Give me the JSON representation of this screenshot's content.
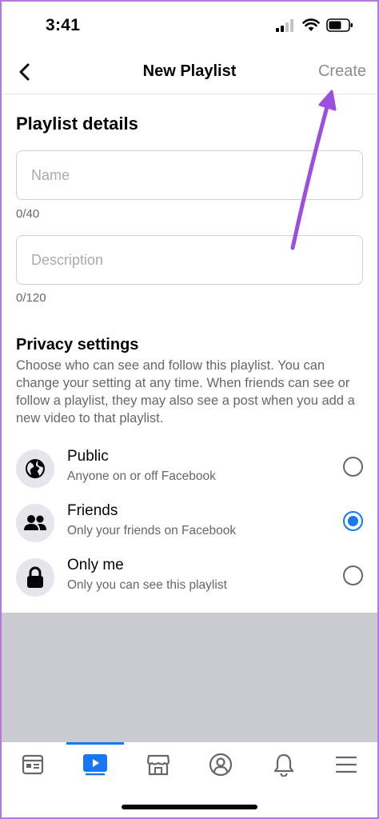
{
  "status_bar": {
    "time": "3:41"
  },
  "header": {
    "title": "New Playlist",
    "create_label": "Create"
  },
  "details": {
    "title": "Playlist details",
    "name": {
      "placeholder": "Name",
      "value": "",
      "counter": "0/40"
    },
    "description": {
      "placeholder": "Description",
      "value": "",
      "counter": "0/120"
    }
  },
  "privacy": {
    "title": "Privacy settings",
    "description": "Choose who can see and follow this playlist. You can change your setting at any time. When friends can see or follow a playlist, they may also see a post when you add a new video to that playlist.",
    "options": [
      {
        "label": "Public",
        "sublabel": "Anyone on or off Facebook",
        "icon": "globe-icon",
        "selected": false
      },
      {
        "label": "Friends",
        "sublabel": "Only your friends on Facebook",
        "icon": "friends-icon",
        "selected": true
      },
      {
        "label": "Only me",
        "sublabel": "Only you can see this playlist",
        "icon": "lock-icon",
        "selected": false
      }
    ]
  },
  "tab_bar": {
    "tabs": [
      {
        "name": "news-feed-icon",
        "active": false
      },
      {
        "name": "watch-icon",
        "active": true
      },
      {
        "name": "marketplace-icon",
        "active": false
      },
      {
        "name": "profile-icon",
        "active": false
      },
      {
        "name": "notifications-icon",
        "active": false
      },
      {
        "name": "menu-icon",
        "active": false
      }
    ]
  },
  "colors": {
    "accent": "#1877f2",
    "annotation_arrow": "#9b4ee0",
    "overlay": "#c9cbd0"
  }
}
